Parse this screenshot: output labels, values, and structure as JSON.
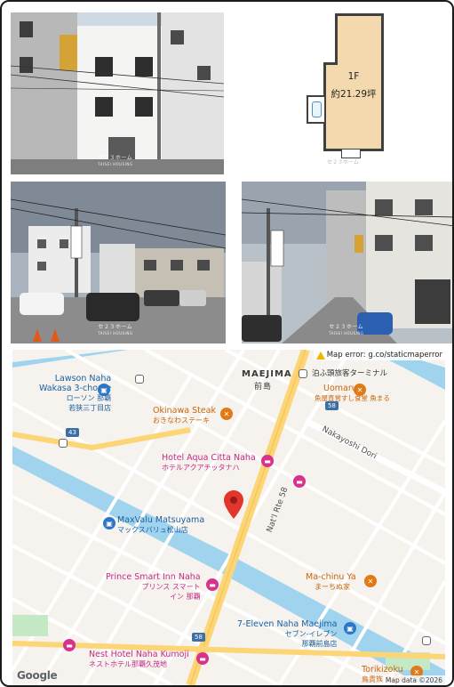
{
  "photos": {
    "watermark_jp": "セ２３ホーム",
    "watermark_en": "TAISEI HOUSING"
  },
  "floorplan": {
    "floor": "1F",
    "area": "約21.29坪",
    "watermark": "セ２３ホーム"
  },
  "map": {
    "error_text": "Map error: g.co/staticmaperror",
    "area_en": "MAEJIMA",
    "area_jp": "前島",
    "terminal": "泊ふ頭旅客ターミナル",
    "road_shield_43": "43",
    "road_shield_58a": "58",
    "road_shield_58b": "58",
    "streets": {
      "nakayoshi": "Nakayoshi Dori",
      "natl": "Nat'l Rte 58"
    },
    "pois": [
      {
        "name": "Lawson Naha",
        "name2": "Wakasa 3-chome",
        "jp": "ローソン 那覇",
        "jp2": "若狭三丁目店",
        "kind": "blue"
      },
      {
        "name": "Okinawa Steak",
        "jp": "おきなわステーキ",
        "kind": "orange"
      },
      {
        "name": "Uomaru",
        "jp": "魚屋直営すし食堂 魚まる",
        "kind": "orange"
      },
      {
        "name": "Hotel Aqua Citta Naha",
        "jp": "ホテルアクアチッタナハ",
        "kind": "pink"
      },
      {
        "name": "MaxValu Matsuyama",
        "jp": "マックスバリュ松山店",
        "kind": "blue"
      },
      {
        "name": "Prince Smart Inn Naha",
        "jp": "プリンス スマート",
        "jp2": "イン 那覇",
        "kind": "pink"
      },
      {
        "name": "Ma-chinu Ya",
        "jp": "まーちぬ家",
        "kind": "orange"
      },
      {
        "name": "7-Eleven Naha Maejima",
        "jp": "セブン-イレブン",
        "jp2": "那覇前島店",
        "kind": "blue"
      },
      {
        "name": "Nest Hotel Naha Kumoji",
        "jp": "ネストホテル那覇久茂地",
        "kind": "pink"
      },
      {
        "name": "Torikizoku",
        "jp": "鳥貴族 美栄橋",
        "kind": "orange"
      }
    ],
    "google": "Google",
    "mapdata": "Map data ©2026"
  },
  "colors": {
    "water": "#9fd3ee",
    "road_major": "#fcd676",
    "road_minor": "#ffffff",
    "map_bg": "#f6f3ee",
    "pin_red": "#e2352c"
  }
}
